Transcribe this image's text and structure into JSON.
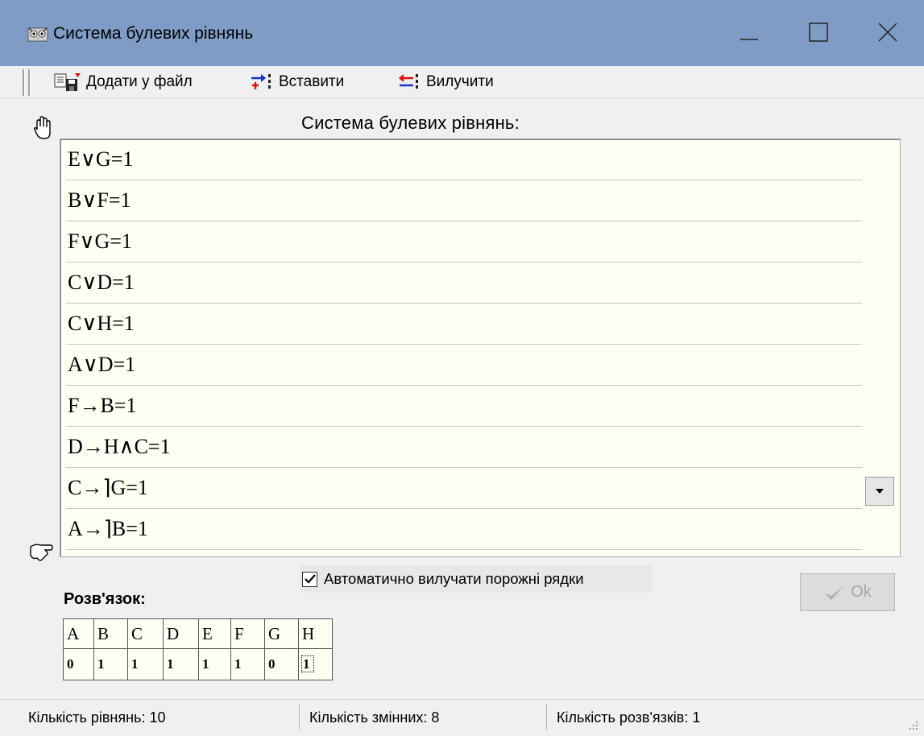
{
  "window": {
    "title": "Система булевих рівнянь",
    "app_icon": "owl-icon",
    "controls": [
      "minimize-icon",
      "maximize-icon",
      "close-icon"
    ]
  },
  "toolbar": {
    "add_to_file_label": "Додати у файл",
    "insert_label": "Вставити",
    "remove_label": "Вилучити"
  },
  "equations": {
    "caption": "Система булевих рівнянь:",
    "items": [
      "E∨G=1",
      "B∨F=1",
      "F∨G=1",
      "C∨D=1",
      "C∨H=1",
      "A∨D=1",
      "F→B=1",
      "D→H∧C=1",
      "C→⌉G=1",
      "A→⌉B=1"
    ]
  },
  "options": {
    "auto_remove_empty_label": "Автоматично вилучати порожні рядки",
    "auto_remove_empty_checked": true
  },
  "ok_button": {
    "label": "Ok",
    "enabled": false
  },
  "solution": {
    "label": "Розв'язок:",
    "headers": [
      "A",
      "B",
      "C",
      "D",
      "E",
      "F",
      "G",
      "H"
    ],
    "values": [
      "0",
      "1",
      "1",
      "1",
      "1",
      "1",
      "0",
      "1"
    ]
  },
  "status": {
    "equations_count": "Кількість рівнянь: 10",
    "variables_count": "Кількість змінних: 8",
    "solutions_count": "Кількість розв'язків: 1"
  },
  "colors": {
    "titlebar": "#7f9cc6",
    "list_background": "#fffff4",
    "insert_icon_red": "#e01010",
    "insert_icon_blue": "#1a2fd0"
  }
}
